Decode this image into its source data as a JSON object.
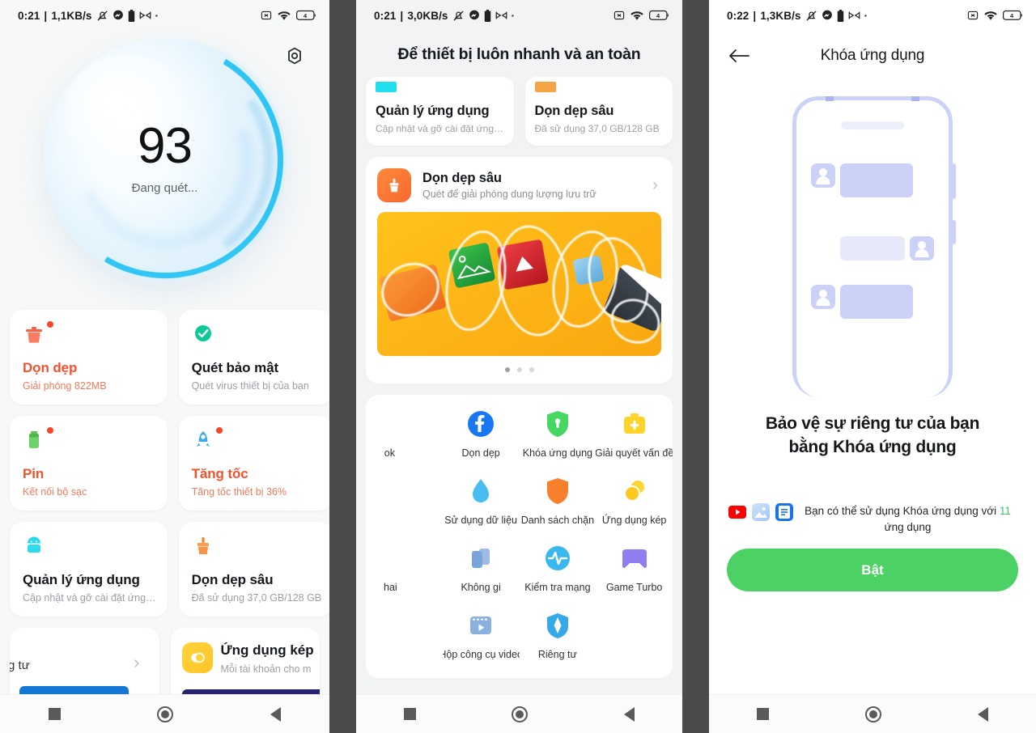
{
  "panel1": {
    "status": {
      "time": "0:21",
      "net_speed": "1,1KB/s",
      "icons": [
        "dnd-off-icon",
        "messenger-icon",
        "battery-saver-icon",
        "mi-icon",
        "dot-icon"
      ],
      "right_icons": [
        "no-sim-icon",
        "wifi-icon",
        "battery-icon"
      ],
      "battery_level": "4"
    },
    "settings_icon": "gear-icon",
    "score": {
      "value": "93",
      "label": "Đang quét..."
    },
    "cards": [
      {
        "title": "Dọn dẹp",
        "sub": "Giải phóng 822MB",
        "icon": "trash-pot-icon",
        "warn": true,
        "dot": true
      },
      {
        "title": "Quét bảo mật",
        "sub": "Quét virus thiết bị của bạn",
        "icon": "shield-check-icon",
        "warn": false,
        "dot": false
      },
      {
        "title": "Pin",
        "sub": "Kết nối bộ sạc",
        "icon": "battery-icon",
        "warn": true,
        "dot": true
      },
      {
        "title": "Tăng tốc",
        "sub": "Tăng tốc thiết bị 36%",
        "icon": "rocket-icon",
        "warn": true,
        "dot": true
      },
      {
        "title": "Quản lý ứng dụng",
        "sub": "Cập nhật và gỡ cài đặt ứng…",
        "icon": "android-box-icon",
        "warn": false,
        "dot": false
      },
      {
        "title": "Dọn dẹp sâu",
        "sub": "Đã sử dụng 37,0 GB/128 GB",
        "icon": "broom-icon",
        "warn": false,
        "dot": false
      }
    ],
    "partial_left": {
      "text": "iêng tư",
      "chevron": "chevron-right-icon"
    },
    "partial_right": {
      "title": "Ứng dụng kép",
      "sub": "Mỗi tài khoản cho m",
      "icon": "dual-apps-icon"
    },
    "navbar": [
      "recents-button",
      "home-button",
      "back-button"
    ]
  },
  "panel2": {
    "status": {
      "time": "0:21",
      "net_speed": "3,0KB/s",
      "battery_level": "4"
    },
    "title": "Để thiết bị luôn nhanh và an toàn",
    "top_cards": [
      {
        "title": "Quản lý ứng dụng",
        "sub": "Cập nhật và gỡ cài đặt ứng…",
        "bar_color": "#22dff0"
      },
      {
        "title": "Dọn dẹp sâu",
        "sub": "Đã sử dụng 37,0 GB/128 GB",
        "bar_color": "#f5a545"
      }
    ],
    "deep_clean": {
      "title": "Dọn dẹp sâu",
      "sub": "Quét để giải phóng dung lượng lưu trữ",
      "icon": "broom-square-icon",
      "chevron": "chevron-right-icon"
    },
    "carousel": {
      "dots": 3,
      "active": 0,
      "banner": "cleanup-promo-banner"
    },
    "grid": [
      {
        "label": "ok",
        "icon": "facebook-icon",
        "clipped": true
      },
      {
        "label": "Dọn dẹp ",
        "icon": "facebook-icon",
        "clipped": true
      },
      {
        "label": "Khóa ứng dụng",
        "icon": "lock-shield-icon"
      },
      {
        "label": "Giải quyết vấn đề",
        "icon": "first-aid-icon"
      },
      {
        "label": "",
        "icon": ""
      },
      {
        "label": "Sử dụng dữ liệu",
        "icon": "water-drop-icon"
      },
      {
        "label": "Danh sách chặn",
        "icon": "orange-shield-icon"
      },
      {
        "label": "Ứng dụng kép",
        "icon": "dual-apps-circles-icon"
      },
      {
        "label": "hai",
        "icon": "",
        "clipped": true
      },
      {
        "label": "Không gi",
        "icon": "second-space-icon",
        "clipped": true
      },
      {
        "label": "Kiểm tra mạng",
        "icon": "network-pulse-icon"
      },
      {
        "label": "Game Turbo",
        "icon": "gamepad-icon"
      },
      {
        "label": "",
        "icon": ""
      },
      {
        "label": "Hộp công cụ video",
        "icon": "video-toolbox-icon"
      },
      {
        "label": "Riêng tư",
        "icon": "privacy-icon"
      },
      {
        "label": "",
        "icon": ""
      }
    ],
    "navbar": [
      "recents-button",
      "home-button",
      "back-button"
    ]
  },
  "panel3": {
    "status": {
      "time": "0:22",
      "net_speed": "1,3KB/s",
      "battery_level": "4"
    },
    "back_icon": "back-arrow-icon",
    "title": "Khóa ứng dụng",
    "illustration": "phone-chat-illustration",
    "heading_line1": "Bảo vệ sự riêng tư của bạn",
    "heading_line2": "bằng Khóa ứng dụng",
    "note_prefix": "Bạn có thể sử dụng Khóa ứng dụng với ",
    "note_count": "11",
    "note_suffix": " ứng dụng",
    "app_icons": [
      "youtube-icon",
      "gallery-icon",
      "docs-icon"
    ],
    "cta_label": "Bật",
    "cta_color": "#4cd264",
    "navbar": [
      "recents-button",
      "home-button",
      "back-button"
    ]
  }
}
